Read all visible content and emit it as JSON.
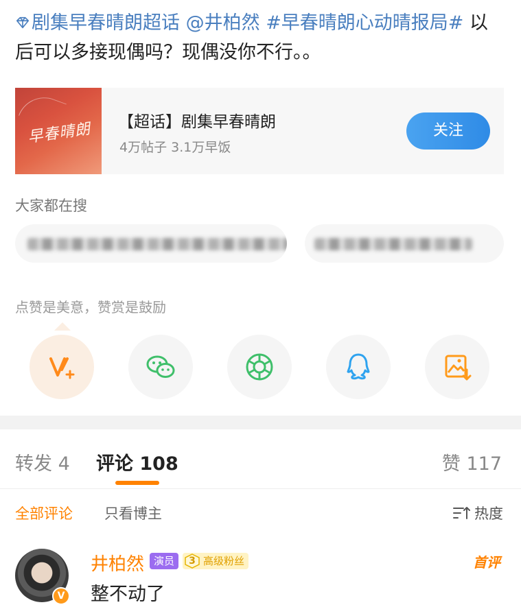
{
  "post": {
    "topic_link": "剧集早春晴朗超话",
    "mention": "@井柏然",
    "hashtag": "#早春晴朗心动晴报局#",
    "body": "以后可以多接现偶吗？现偶没你不行。。"
  },
  "topic_card": {
    "cover_text": "早春晴朗",
    "title": "【超话】剧集早春晴朗",
    "stats": "4万帖子 3.1万早饭",
    "follow_label": "关注"
  },
  "search": {
    "label": "大家都在搜"
  },
  "reward": {
    "label": "点赞是美意，赞赏是鼓励"
  },
  "share_icons": [
    "reward-v-plus-icon",
    "wechat-icon",
    "moments-icon",
    "qq-icon",
    "save-image-icon"
  ],
  "tabs": {
    "repost": "转发 4",
    "comment": "评论 108",
    "like": "赞 117"
  },
  "filters": {
    "all": "全部评论",
    "owner_only": "只看博主",
    "sort": "热度"
  },
  "comment": {
    "author": "井柏然",
    "role_badge": "演员",
    "fan_level": "3",
    "fan_badge": "高级粉丝",
    "first_badge": "首评",
    "text": "整不动了",
    "verified_badge": "V"
  },
  "colors": {
    "accent": "#ff8200",
    "link": "#4a7fbf",
    "follow": "#2f8be6"
  }
}
